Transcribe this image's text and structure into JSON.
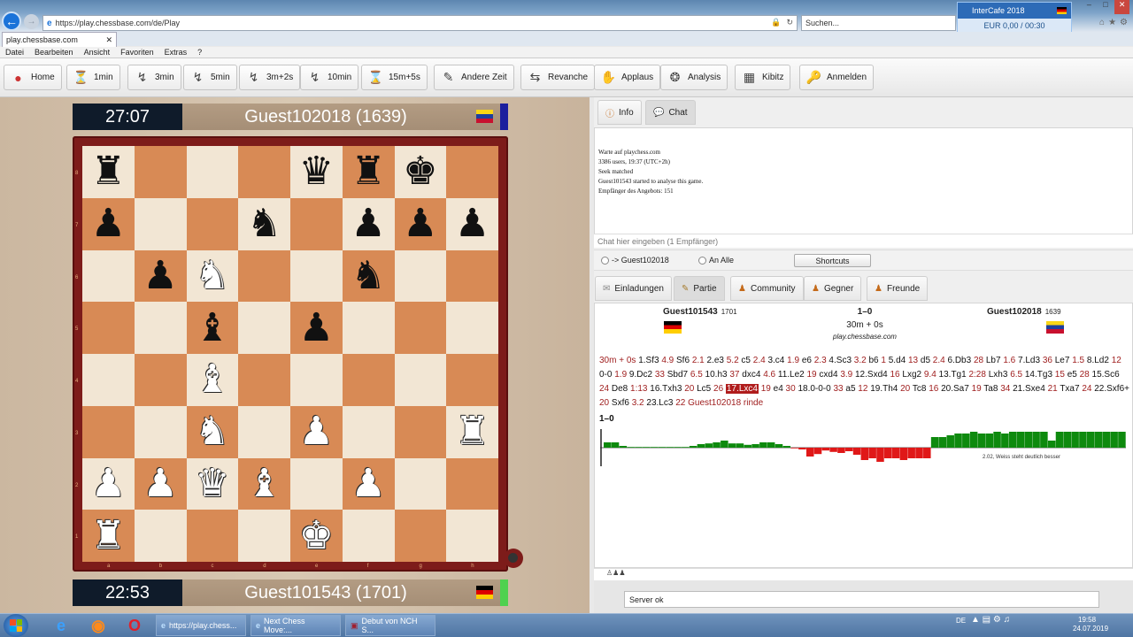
{
  "browser": {
    "url": "https://play.chessbase.com/de/Play",
    "search_placeholder": "Suchen...",
    "tab_title": "play.chessbase.com",
    "menu": [
      "Datei",
      "Bearbeiten",
      "Ansicht",
      "Favoriten",
      "Extras",
      "?"
    ]
  },
  "intercafe": {
    "title": "InterCafe 2018",
    "balance": "EUR 0,00 / 00:30"
  },
  "toolbar": {
    "buttons": [
      "Home",
      "1min",
      "3min",
      "5min",
      "3m+2s",
      "10min",
      "15m+5s",
      "Andere Zeit",
      "Revanche",
      "Applaus",
      "Analysis",
      "Kibitz",
      "Anmelden"
    ]
  },
  "top_player": {
    "clock": "27:07",
    "name": "Guest102018 (1639)",
    "flag": "ve"
  },
  "bottom_player": {
    "clock": "22:53",
    "name": "Guest101543 (1701)",
    "flag": "de"
  },
  "board": {
    "files": [
      "a",
      "b",
      "c",
      "d",
      "e",
      "f",
      "g",
      "h"
    ],
    "ranks": [
      "8",
      "7",
      "6",
      "5",
      "4",
      "3",
      "2",
      "1"
    ],
    "rows": [
      [
        "bR",
        "",
        "",
        "",
        "bQ",
        "bR",
        "bK",
        ""
      ],
      [
        "bP",
        "",
        "",
        "bN",
        "",
        "bP",
        "bP",
        "bP"
      ],
      [
        "",
        "bP",
        "wN",
        "",
        "",
        "bN",
        "",
        ""
      ],
      [
        "",
        "",
        "bB",
        "",
        "bP",
        "",
        "",
        ""
      ],
      [
        "",
        "",
        "wB",
        "",
        "",
        "",
        "",
        ""
      ],
      [
        "",
        "",
        "wN",
        "",
        "wP",
        "",
        "",
        "wR"
      ],
      [
        "wP",
        "wP",
        "wQ",
        "wB",
        "",
        "wP",
        "",
        ""
      ],
      [
        "wR",
        "",
        "",
        "",
        "wK",
        "",
        "",
        ""
      ]
    ]
  },
  "panel": {
    "tabs_top": [
      "Info",
      "Chat"
    ],
    "chat_messages": [
      "Warte auf playchess.com",
      "3386 users, 19:37 (UTC+2h)",
      "Seek matched",
      "Guest101543 started to analyse this game.",
      "Empfänger des Angebots: 151"
    ],
    "chat_placeholder": "Chat hier eingeben (1 Empfänger)",
    "recipient_1": "-> Guest102018",
    "recipient_2": "An Alle",
    "shortcuts": "Shortcuts",
    "tabs_bottom": [
      "Einladungen",
      "Partie",
      "Community",
      "Gegner",
      "Freunde"
    ]
  },
  "game": {
    "white": "Guest101543",
    "white_elo": "1701",
    "black": "Guest102018",
    "black_elo": "1639",
    "result": "1–0",
    "time_control": "30m + 0s",
    "site": "play.chessbase.com",
    "moves_line1": [
      [
        "t",
        "30m + 0s"
      ],
      [
        "m",
        " 1.Sf3 "
      ],
      [
        "t",
        "4.9"
      ],
      [
        "m",
        " Sf6 "
      ],
      [
        "t",
        "2.1"
      ],
      [
        "m",
        " 2.e3 "
      ],
      [
        "t",
        "5.2"
      ],
      [
        "m",
        " c5 "
      ],
      [
        "t",
        "2.4"
      ],
      [
        "m",
        " 3.c4 "
      ],
      [
        "t",
        "1.9"
      ],
      [
        "m",
        " e6 "
      ],
      [
        "t",
        "2.3"
      ],
      [
        "m",
        " 4.Sc3 "
      ],
      [
        "t",
        "3.2"
      ],
      [
        "m",
        " b6 "
      ],
      [
        "t",
        "1"
      ],
      [
        "m",
        " 5.d4 "
      ],
      [
        "t",
        "13"
      ],
      [
        "m",
        " d5 "
      ],
      [
        "t",
        "2.4"
      ],
      [
        "m",
        " 6.Db3 "
      ],
      [
        "t",
        "28"
      ],
      [
        "m",
        " Lb7 "
      ],
      [
        "t",
        "1.6"
      ],
      [
        "m",
        " 7.Ld3 "
      ],
      [
        "t",
        "36"
      ],
      [
        "m",
        " Le7 "
      ],
      [
        "t",
        "1.5"
      ],
      [
        "m",
        " 8.Ld2 "
      ],
      [
        "t",
        "12"
      ]
    ],
    "moves_line2": [
      [
        "m",
        "0-0 "
      ],
      [
        "t",
        "1.9"
      ],
      [
        "m",
        " 9.Dc2 "
      ],
      [
        "t",
        "33"
      ],
      [
        "m",
        " Sbd7 "
      ],
      [
        "t",
        "6.5"
      ],
      [
        "m",
        " 10.h3 "
      ],
      [
        "t",
        "37"
      ],
      [
        "m",
        " dxc4 "
      ],
      [
        "t",
        "4.6"
      ],
      [
        "m",
        " 11.Le2 "
      ],
      [
        "t",
        "19"
      ],
      [
        "m",
        " cxd4 "
      ],
      [
        "t",
        "3.9"
      ],
      [
        "m",
        " 12.Sxd4 "
      ],
      [
        "t",
        "16"
      ],
      [
        "m",
        " Lxg2 "
      ],
      [
        "t",
        "9.4"
      ],
      [
        "m",
        " 13.Tg1 "
      ],
      [
        "t",
        "2:28"
      ],
      [
        "m",
        " Lxh3 "
      ],
      [
        "t",
        "6.5"
      ],
      [
        "m",
        " 14.Tg3 "
      ],
      [
        "t",
        "15"
      ],
      [
        "m",
        " e5 "
      ],
      [
        "t",
        "28"
      ],
      [
        "m",
        " 15.Sc6"
      ]
    ],
    "moves_line3": [
      [
        "t",
        "24"
      ],
      [
        "m",
        " De8 "
      ],
      [
        "t",
        "1:13"
      ],
      [
        "m",
        " 16.Txh3 "
      ],
      [
        "t",
        "20"
      ],
      [
        "m",
        " Lc5 "
      ],
      [
        "t",
        "26"
      ],
      [
        "m",
        " "
      ],
      [
        "h",
        "17.Lxc4"
      ],
      [
        "m",
        " "
      ],
      [
        "t",
        "19"
      ],
      [
        "m",
        " e4 "
      ],
      [
        "t",
        "30"
      ],
      [
        "m",
        " 18.0-0-0 "
      ],
      [
        "t",
        "33"
      ],
      [
        "m",
        " a5 "
      ],
      [
        "t",
        "12"
      ],
      [
        "m",
        " 19.Th4 "
      ],
      [
        "t",
        "20"
      ],
      [
        "m",
        " Tc8 "
      ],
      [
        "t",
        "16"
      ],
      [
        "m",
        " 20.Sa7 "
      ],
      [
        "t",
        "19"
      ],
      [
        "m",
        " Ta8 "
      ],
      [
        "t",
        "34"
      ],
      [
        "m",
        " 21.Sxe4 "
      ],
      [
        "t",
        "21"
      ],
      [
        "m",
        " Txa7 "
      ],
      [
        "t",
        "24"
      ],
      [
        "m",
        " 22.Sxf6+"
      ]
    ],
    "moves_line4": [
      [
        "t",
        "20"
      ],
      [
        "m",
        " Sxf6 "
      ],
      [
        "t",
        "3.2"
      ],
      [
        "m",
        " 23.Lc3 "
      ],
      [
        "t",
        "22"
      ],
      [
        "m",
        " "
      ],
      [
        "t",
        "Guest102018 rinde"
      ]
    ],
    "result_line": "1–0",
    "eval_note": "2.02, Weiss steht deutlich besser",
    "eval_values": [
      0.15,
      0.15,
      0.05,
      0.02,
      0.02,
      0.02,
      0.02,
      0.02,
      0.02,
      0.02,
      0.02,
      0.05,
      0.1,
      0.12,
      0.15,
      0.2,
      0.12,
      0.12,
      0.08,
      0.1,
      0.15,
      0.15,
      0.1,
      0.05,
      -0.02,
      -0.05,
      -0.25,
      -0.18,
      -0.08,
      -0.12,
      -0.15,
      -0.1,
      -0.2,
      -0.35,
      -0.3,
      -0.4,
      -0.3,
      -0.3,
      -0.35,
      -0.3,
      -0.3,
      -0.3,
      0.3,
      0.3,
      0.35,
      0.4,
      0.4,
      0.45,
      0.4,
      0.4,
      0.45,
      0.4,
      0.45,
      0.45,
      0.45,
      0.45,
      0.45,
      0.2,
      0.45,
      0.45,
      0.45,
      0.45,
      0.45,
      0.45,
      0.45,
      0.45,
      0.45
    ]
  },
  "status": {
    "text": "Server ok"
  },
  "taskbar": {
    "items": [
      "https://play.chess...",
      "Next Chess Move:...",
      "Debut von NCH S..."
    ],
    "time": "19:58",
    "date": "24.07.2019",
    "lang": "DE"
  }
}
